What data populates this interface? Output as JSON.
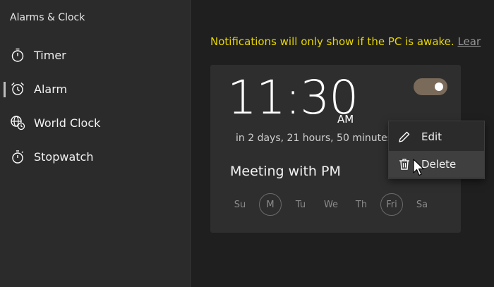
{
  "app": {
    "title": "Alarms & Clock"
  },
  "sidebar": {
    "items": [
      {
        "label": "Timer",
        "icon": "timer-icon",
        "selected": false
      },
      {
        "label": "Alarm",
        "icon": "alarm-icon",
        "selected": true
      },
      {
        "label": "World Clock",
        "icon": "world-clock-icon",
        "selected": false
      },
      {
        "label": "Stopwatch",
        "icon": "stopwatch-icon",
        "selected": false
      }
    ]
  },
  "main": {
    "notice": "Notifications will only show if the PC is awake.",
    "learn_more": "Lear"
  },
  "alarm": {
    "time": "11:30",
    "ampm": "AM",
    "remaining": "in 2 days, 21 hours, 50 minutes",
    "name": "Meeting with PM",
    "enabled": true,
    "toggle_color": "#7a6a5a",
    "days": [
      {
        "label": "Su",
        "active": false
      },
      {
        "label": "M",
        "active": true
      },
      {
        "label": "Tu",
        "active": false
      },
      {
        "label": "We",
        "active": false
      },
      {
        "label": "Th",
        "active": false
      },
      {
        "label": "Fri",
        "active": true
      },
      {
        "label": "Sa",
        "active": false
      }
    ]
  },
  "context_menu": {
    "edit_label": "Edit",
    "delete_label": "Delete"
  },
  "colors": {
    "notice": "#e8d700",
    "background": "#1f1f1f",
    "sidebar": "#2b2b2b",
    "card": "#2e2e2e"
  }
}
